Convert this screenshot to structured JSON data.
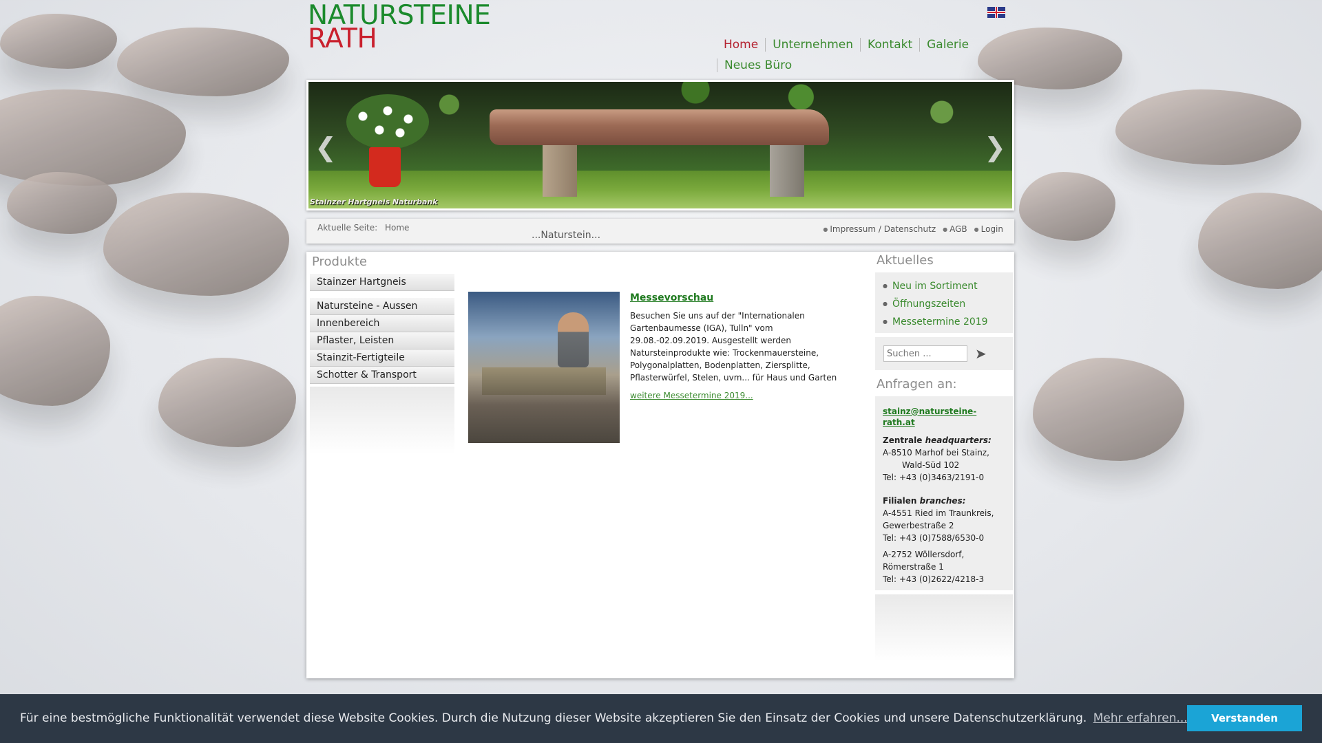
{
  "brand": {
    "line1": "NATURSTEINE",
    "line2": "RATH"
  },
  "nav": [
    {
      "label": "Home",
      "active": true
    },
    {
      "label": "Unternehmen",
      "active": false
    },
    {
      "label": "Kontakt",
      "active": false
    },
    {
      "label": "Galerie",
      "active": false
    },
    {
      "label": "Neues Büro",
      "active": false
    }
  ],
  "slider": {
    "caption": "Stainzer Hartgneis Naturbank",
    "prev_icon": "chevron-left-icon",
    "next_icon": "chevron-right-icon"
  },
  "breadcrumb": {
    "label": "Aktuelle Seite:",
    "current": "Home",
    "slogan": "...Naturstein..."
  },
  "toplinks": [
    "Impressum / Datenschutz",
    "AGB",
    "Login"
  ],
  "products": {
    "heading": "Produkte",
    "items": [
      "Stainzer Hartgneis",
      "Natursteine - Aussen",
      "Innenbereich",
      "Pflaster, Leisten",
      "Stainzit-Fertigteile",
      "Schotter & Transport"
    ]
  },
  "article": {
    "title": "Messevorschau",
    "body": "Besuchen Sie uns auf der \"Internationalen Gartenbaumesse (IGA), Tulln\" vom 29.08.-02.09.2019. Ausgestellt werden Natursteinprodukte wie: Trockenmauersteine, Polygonalplatten, Bodenplatten, Ziersplitte, Pflasterwürfel, Stelen, uvm... für Haus und Garten",
    "more": "weitere Messetermine 2019..."
  },
  "aktuelles": {
    "heading": "Aktuelles",
    "items": [
      "Neu im Sortiment",
      "Öffnungszeiten",
      "Messetermine 2019"
    ]
  },
  "search": {
    "placeholder": "Suchen ..."
  },
  "anfragen": {
    "heading": "Anfragen an:",
    "email": "stainz@natursteine-rath.at",
    "hq_label": "Zentrale",
    "hq_label_en": "headquarters:",
    "hq_line1": "A-8510 Marhof bei Stainz,",
    "hq_line2": "Wald-Süd 102",
    "hq_tel": "Tel:  +43 (0)3463/2191-0",
    "br_label": "Filialen",
    "br_label_en": "branches:",
    "br1_line1": "A-4551 Ried im Traunkreis,",
    "br1_line2": "Gewerbestraße 2",
    "br1_tel": "Tel:  +43 (0)7588/6530-0",
    "br2_line1": "A-2752 Wöllersdorf,",
    "br2_line2": "Römerstraße 1",
    "br2_tel": "Tel:  +43 (0)2622/4218-3"
  },
  "cookie": {
    "message": "Für eine bestmögliche Funktionalität verwendet diese Website Cookies. Durch die Nutzung dieser Website akzeptieren Sie den Einsatz der Cookies und unsere Datenschutzerklärung.",
    "more": "Mehr erfahren...",
    "accept": "Verstanden"
  },
  "colors": {
    "brand_green": "#1b8a2c",
    "brand_red": "#c9202d",
    "link_green": "#3a8a2e",
    "cookie_bg": "#2d3845",
    "cookie_button": "#1ba4d6"
  }
}
